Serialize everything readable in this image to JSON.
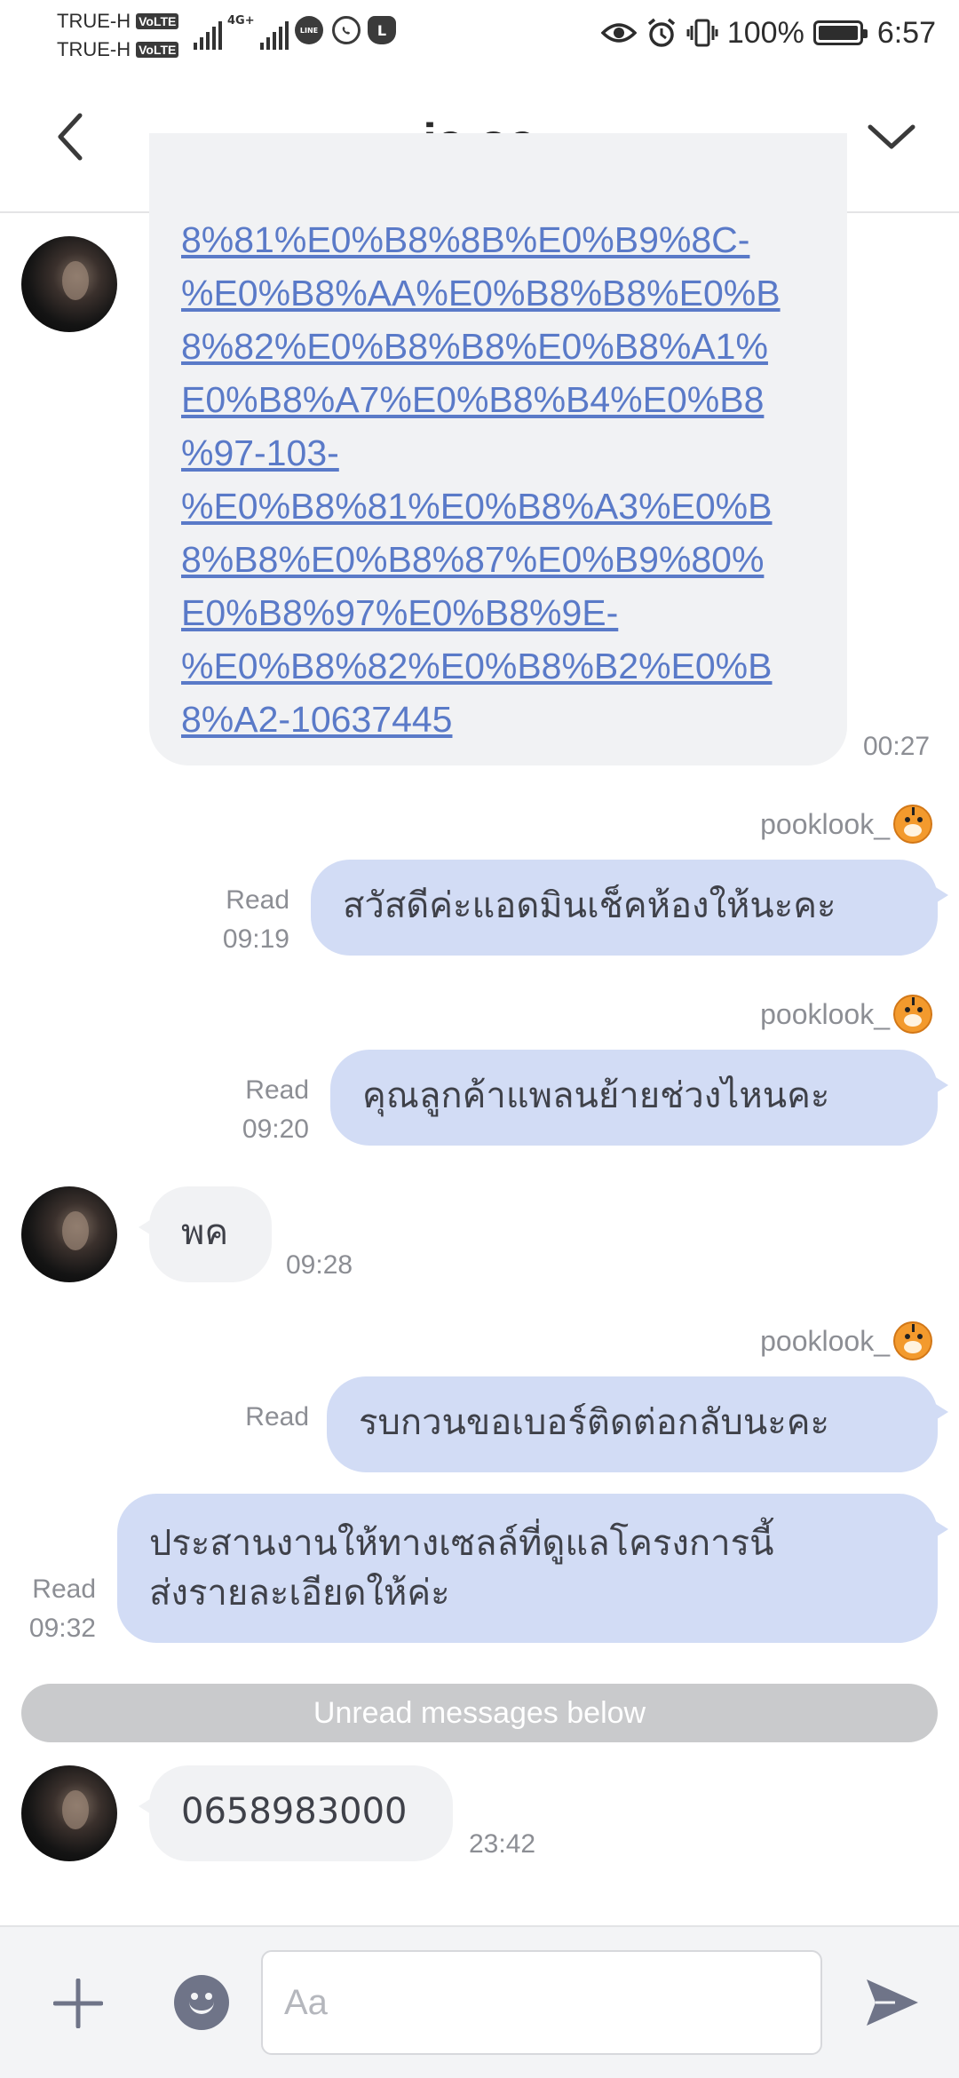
{
  "status_bar": {
    "carrier_1": "TRUE-H",
    "carrier_2": "TRUE-H",
    "volte": "VoLTE",
    "network": "4G+",
    "network_sub": "1",
    "app_icon_line": "LINE",
    "app_icon_l": "L",
    "battery": "100%",
    "time": "6:57",
    "icons": [
      "eye-icon",
      "alarm-icon",
      "vibrate-icon",
      "battery-icon"
    ]
  },
  "header": {
    "title": "ja oa",
    "back_icon": "chevron-left-icon",
    "menu_icon": "chevron-down-icon"
  },
  "messages": {
    "link": {
      "text": "8%81%E0%B8%8B%E0%B9%8C-\n%E0%B8%AA%E0%B8%B8%E0%B\n8%82%E0%B8%B8%E0%B8%A1%\nE0%B8%A7%E0%B8%B4%E0%B8\n%97-103-\n%E0%B8%81%E0%B8%A3%E0%B\n8%B8%E0%B8%87%E0%B9%80%\nE0%B8%97%E0%B8%9E-\n%E0%B8%82%E0%B8%B2%E0%B\n8%A2-10637445",
      "time": "00:27"
    },
    "m1": {
      "sender": "pooklook_",
      "text": "สวัสดีค่ะแอดมินเช็คห้องให้นะคะ",
      "read": "Read",
      "time": "09:19"
    },
    "m2": {
      "sender": "pooklook_",
      "text": "คุณลูกค้าแพลนย้ายช่วงไหนคะ",
      "read": "Read",
      "time": "09:20"
    },
    "m3": {
      "text": "พค",
      "time": "09:28"
    },
    "m4": {
      "sender": "pooklook_",
      "text": "รบกวนขอเบอร์ติดต่อกลับนะคะ",
      "read": "Read"
    },
    "m5": {
      "line1": "ประสานงานให้ทางเซลล์ที่ดูแลโครงการนี้",
      "line2": "ส่งรายละเอียดให้ค่ะ",
      "read": "Read",
      "time": "09:32"
    },
    "unread_divider": "Unread messages below",
    "m6": {
      "text": "0658983000",
      "time": "23:42"
    }
  },
  "input_bar": {
    "placeholder": "Aa",
    "plus_icon": "plus-icon",
    "emoji_icon": "emoji-icon",
    "send_icon": "send-icon"
  },
  "colors": {
    "outgoing_bubble": "#d2dcf5",
    "incoming_bubble": "#f1f2f4",
    "link": "#5a7ac8",
    "meta_text": "#8c8e94",
    "unread_bar": "#c9cacc"
  }
}
